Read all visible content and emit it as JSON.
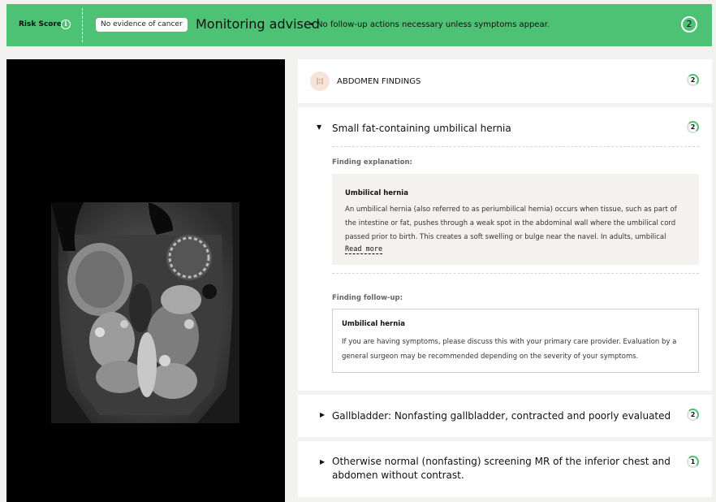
{
  "banner": {
    "risk_label": "Risk Score",
    "info_icon": "i",
    "status_pill": "No evidence of cancer",
    "title": "Monitoring advised",
    "subtitle": "• No follow-up actions necessary unless symptoms appear.",
    "score": "2",
    "color": "#4dc174"
  },
  "section": {
    "title": "ABDOMEN FINDINGS",
    "badge": "2",
    "icon": "abdomen-icon"
  },
  "findings": [
    {
      "title": "Small fat-containing umbilical hernia",
      "badge": "2",
      "expanded": true,
      "explanation_label": "Finding explanation:",
      "explanation_title": "Umbilical hernia",
      "explanation_body": "An umbilical hernia (also referred to as periumbilical hernia) occurs when tissue, such as part of the intestine or fat, pushes through a weak spot in the abdominal wall where the umbilical cord passed prior to birth. This creates a soft swelling or bulge near the navel. In adults, umbilical",
      "read_more": "Read more",
      "followup_label": "Finding follow-up:",
      "followup_title": "Umbilical hernia",
      "followup_body": "If you are having symptoms, please discuss this with your primary care provider. Evaluation by a general surgeon may be recommended depending on the severity of your symptoms."
    },
    {
      "title": "Gallbladder: Nonfasting gallbladder, contracted and poorly evaluated",
      "badge": "2",
      "expanded": false
    },
    {
      "title": "Otherwise normal (nonfasting) screening MR of the inferior chest and abdomen without contrast.",
      "badge": "1",
      "expanded": false
    }
  ]
}
